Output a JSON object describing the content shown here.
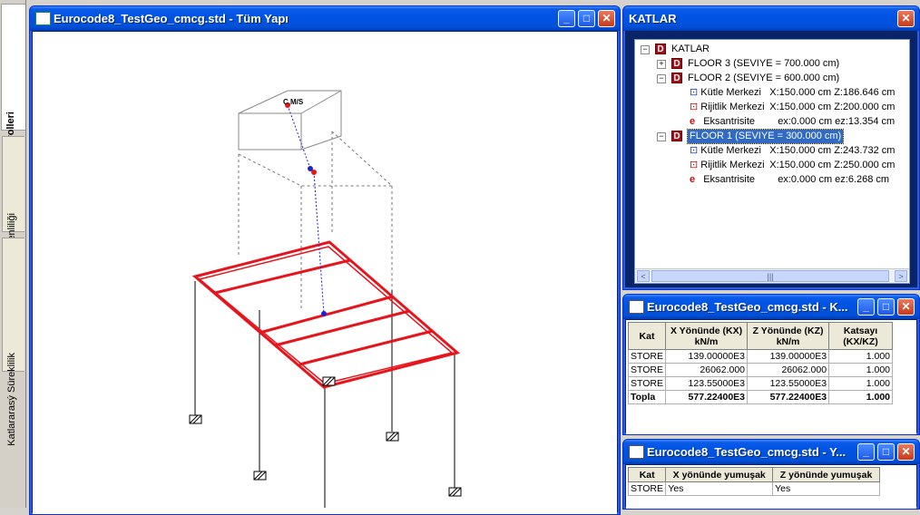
{
  "side_tabs": [
    {
      "label": "Rijitlik Kontrolleri",
      "active": true,
      "icon": "rigidity-icon"
    },
    {
      "label": "Plan Düzenliliği",
      "active": false,
      "icon": "plan-icon"
    },
    {
      "label": "Katlararasý Süreklilik",
      "active": false,
      "icon": "continuity-icon"
    }
  ],
  "main_window": {
    "title": "Eurocode8_TestGeo_cmcg.std - Tüm Yapı",
    "label_cmcs": "C.M/S"
  },
  "tree_window": {
    "title": "KATLAR",
    "root": "KATLAR",
    "floor3": "FLOOR 3 (SEVIYE = 700.000 cm)",
    "floor2": "FLOOR 2 (SEVIYE = 600.000 cm)",
    "f2_mass": "Kütle Merkezi",
    "f2_mass_val": "X:150.000 cm  Z:186.646 cm",
    "f2_rig": "Rijitlik Merkezi",
    "f2_rig_val": "X:150.000 cm  Z:200.000 cm",
    "f2_ecc": "Eksantrisite",
    "f2_ecc_val": "ex:0.000 cm   ez:13.354 cm",
    "floor1": "FLOOR 1 (SEVIYE = 300.000 cm)",
    "f1_mass": "Kütle Merkezi",
    "f1_mass_val": "X:150.000 cm  Z:243.732 cm",
    "f1_rig": "Rijitlik Merkezi",
    "f1_rig_val": "X:150.000 cm  Z:250.000 cm",
    "f1_ecc": "Eksantrisite",
    "f1_ecc_val": "ex:0.000 cm   ez:6.268 cm"
  },
  "stiffness_window": {
    "title": "Eurocode8_TestGeo_cmcg.std - K...",
    "headers": [
      "Kat",
      "X Yönünde (KX) kN/m",
      "Z Yönünde (KZ) kN/m",
      "Katsayı (KX/KZ)"
    ],
    "rows": [
      [
        "STORE",
        "139.00000E3",
        "139.00000E3",
        "1.000"
      ],
      [
        "STORE",
        "26062.000",
        "26062.000",
        "1.000"
      ],
      [
        "STORE",
        "123.55000E3",
        "123.55000E3",
        "1.000"
      ]
    ],
    "total": [
      "Topla",
      "577.22400E3",
      "577.22400E3",
      "1.000"
    ]
  },
  "soft_window": {
    "title": "Eurocode8_TestGeo_cmcg.std - Y...",
    "headers": [
      "Kat",
      "X yönünde yumuşak",
      "Z yönünde yumuşak"
    ],
    "rows": [
      [
        "STORE",
        "Yes",
        "Yes"
      ]
    ]
  },
  "colors": {
    "beam": "#e8141c",
    "frame": "#000000",
    "title_bar": "#0054e3",
    "selection": "#316ac5"
  }
}
